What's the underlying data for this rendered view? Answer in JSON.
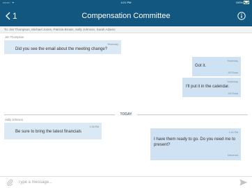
{
  "status_bar": {
    "carrier": "•••••◦ ᯤ",
    "time": "4:21 PM",
    "battery": "100%"
  },
  "header": {
    "back_count": "1",
    "title": "Compensation Committee"
  },
  "recipients": "To: Jim Thompson, Michael Jones, Patricia Brown, Sally Johnson, Sarah Adams",
  "messages": [
    {
      "sender": "Jim Thompson",
      "time": "Yesterday",
      "text": "Did you see the email about the meeting change?"
    },
    {
      "time": "Yesterday",
      "text": "Got it.",
      "status": "3/5 Read"
    },
    {
      "time": "Yesterday",
      "text": "I'll put it in the calendar.",
      "status": "2/5 Read"
    },
    {
      "sender": "Sally Johnson",
      "time": "1:35 PM",
      "text": "Be sure to bring the latest financials"
    },
    {
      "time": "1:40 PM",
      "text": "I have them ready to go. Do you need me to present?",
      "status": "Delivered"
    }
  ],
  "divider_label": "TODAY",
  "composer": {
    "placeholder": "Type a message..."
  }
}
